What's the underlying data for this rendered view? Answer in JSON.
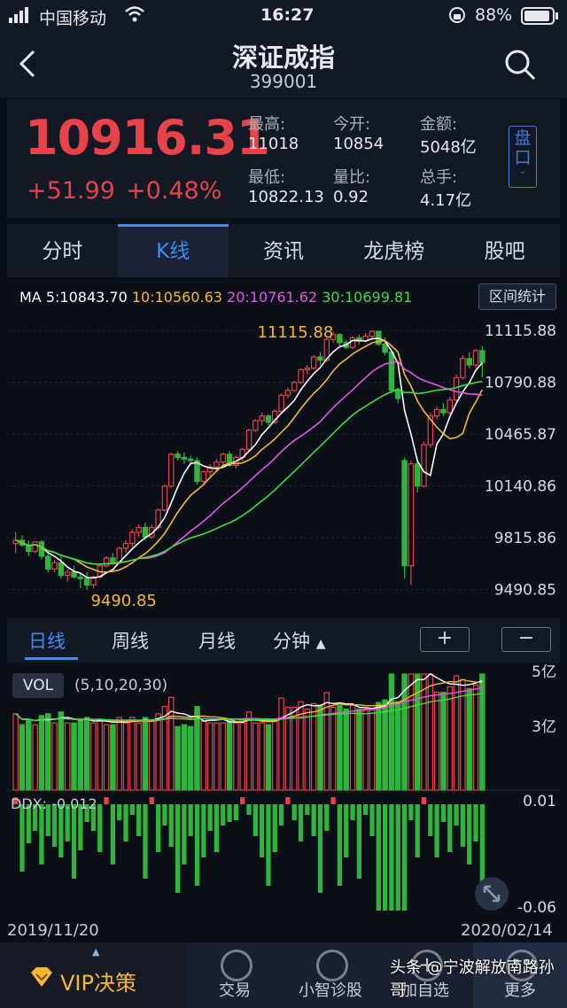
{
  "status_bar": {
    "carrier": "中国移动",
    "time": "16:27",
    "battery": "88%"
  },
  "nav": {
    "title": "深证成指",
    "code": "399001"
  },
  "quote": {
    "price": "10916.31",
    "change": "+51.99",
    "change_pct": "+0.48%",
    "fields": [
      {
        "label": "最高:",
        "value": "11018"
      },
      {
        "label": "今开:",
        "value": "10854"
      },
      {
        "label": "金额:",
        "value": "5048亿"
      },
      {
        "label": "最低:",
        "value": "10822.13"
      },
      {
        "label": "量比:",
        "value": "0.92"
      },
      {
        "label": "总手:",
        "value": "4.17亿"
      }
    ],
    "pankou_label": "盘口"
  },
  "tabs": [
    {
      "label": "分时",
      "active": false
    },
    {
      "label": "K线",
      "active": true
    },
    {
      "label": "资讯",
      "active": false
    },
    {
      "label": "龙虎榜",
      "active": false
    },
    {
      "label": "股吧",
      "active": false
    }
  ],
  "ma_legend": {
    "ma5": "MA 5:10843.70",
    "ma10": "10:10560.63",
    "ma20": "20:10761.62",
    "ma30": "30:10699.81",
    "ma5_color": "#ffffff",
    "ma10_color": "#f5b835",
    "ma20_color": "#e457e6",
    "ma30_color": "#3fdc3f"
  },
  "range_stat_label": "区间统计",
  "period_tabs": {
    "day": "日线",
    "week": "周线",
    "month": "月线",
    "minute": "分钟",
    "plus": "+",
    "minus": "−"
  },
  "vol_legend": {
    "label": "VOL",
    "params": "(5,10,20,30)"
  },
  "ddx_label": "DDX: -0.012",
  "dates": {
    "start": "2019/11/20",
    "end": "2020/02/14"
  },
  "bottom_bar": {
    "vip": "VIP决策",
    "trade": "交易",
    "diagnose": "小智诊股",
    "add": "加自选",
    "more": "更多"
  },
  "watermark": "头条 @宁波解放南路孙哥",
  "chart_data": {
    "type": "candlestick",
    "y_axis_labels": [
      "11115.88",
      "10790.88",
      "10465.87",
      "10140.86",
      "9815.86",
      "9490.85"
    ],
    "ylim": [
      9400,
      11200
    ],
    "annotations": {
      "high": "11115.88",
      "low": "9490.85"
    },
    "ohlc": [
      [
        9780,
        9850,
        9720,
        9800
      ],
      [
        9800,
        9830,
        9760,
        9770
      ],
      [
        9770,
        9800,
        9700,
        9730
      ],
      [
        9730,
        9790,
        9720,
        9790
      ],
      [
        9790,
        9800,
        9680,
        9700
      ],
      [
        9700,
        9730,
        9600,
        9620
      ],
      [
        9620,
        9680,
        9600,
        9660
      ],
      [
        9660,
        9700,
        9560,
        9580
      ],
      [
        9580,
        9620,
        9540,
        9600
      ],
      [
        9600,
        9640,
        9560,
        9570
      ],
      [
        9570,
        9600,
        9500,
        9560
      ],
      [
        9560,
        9600,
        9490,
        9520
      ],
      [
        9520,
        9580,
        9500,
        9570
      ],
      [
        9570,
        9650,
        9560,
        9640
      ],
      [
        9640,
        9700,
        9630,
        9690
      ],
      [
        9690,
        9720,
        9650,
        9660
      ],
      [
        9660,
        9760,
        9650,
        9750
      ],
      [
        9750,
        9800,
        9720,
        9780
      ],
      [
        9780,
        9870,
        9760,
        9850
      ],
      [
        9850,
        9900,
        9820,
        9880
      ],
      [
        9880,
        9910,
        9800,
        9820
      ],
      [
        9820,
        9900,
        9810,
        9880
      ],
      [
        9880,
        10000,
        9870,
        9990
      ],
      [
        9990,
        10150,
        9980,
        10140
      ],
      [
        10140,
        10350,
        10130,
        10340
      ],
      [
        10340,
        10360,
        10300,
        10320
      ],
      [
        10320,
        10350,
        10280,
        10310
      ],
      [
        10310,
        10330,
        10270,
        10300
      ],
      [
        10300,
        10320,
        10150,
        10170
      ],
      [
        10170,
        10240,
        10150,
        10230
      ],
      [
        10230,
        10280,
        10200,
        10260
      ],
      [
        10260,
        10310,
        10230,
        10290
      ],
      [
        10290,
        10350,
        10270,
        10340
      ],
      [
        10340,
        10360,
        10260,
        10270
      ],
      [
        10270,
        10330,
        10250,
        10320
      ],
      [
        10320,
        10380,
        10300,
        10370
      ],
      [
        10370,
        10500,
        10360,
        10490
      ],
      [
        10490,
        10560,
        10480,
        10550
      ],
      [
        10550,
        10600,
        10520,
        10580
      ],
      [
        10580,
        10590,
        10520,
        10540
      ],
      [
        10540,
        10620,
        10530,
        10610
      ],
      [
        10610,
        10720,
        10600,
        10710
      ],
      [
        10710,
        10760,
        10690,
        10740
      ],
      [
        10740,
        10800,
        10730,
        10790
      ],
      [
        10790,
        10880,
        10780,
        10870
      ],
      [
        10870,
        10900,
        10840,
        10880
      ],
      [
        10880,
        10960,
        10870,
        10950
      ],
      [
        10950,
        10980,
        10900,
        10930
      ],
      [
        10930,
        11070,
        10920,
        11060
      ],
      [
        11060,
        11110,
        11040,
        11090
      ],
      [
        11090,
        11100,
        11020,
        11040
      ],
      [
        11040,
        11060,
        11000,
        11010
      ],
      [
        11010,
        11080,
        11000,
        11070
      ],
      [
        11070,
        11090,
        11030,
        11050
      ],
      [
        11050,
        11100,
        11040,
        11080
      ],
      [
        11080,
        11116,
        11060,
        11110
      ],
      [
        11110,
        11116,
        11020,
        11030
      ],
      [
        11030,
        11070,
        10960,
        10980
      ],
      [
        10980,
        10990,
        10720,
        10740
      ],
      [
        10740,
        10760,
        10660,
        10690
      ],
      [
        10300,
        10320,
        9560,
        9640
      ],
      [
        9640,
        10300,
        9520,
        10280
      ],
      [
        10280,
        10320,
        10100,
        10140
      ],
      [
        10140,
        10420,
        10130,
        10400
      ],
      [
        10400,
        10600,
        10380,
        10580
      ],
      [
        10580,
        10640,
        10560,
        10620
      ],
      [
        10620,
        10660,
        10580,
        10600
      ],
      [
        10600,
        10700,
        10590,
        10680
      ],
      [
        10680,
        10840,
        10670,
        10820
      ],
      [
        10820,
        10960,
        10810,
        10940
      ],
      [
        10940,
        10980,
        10880,
        10900
      ],
      [
        10900,
        11000,
        10880,
        10990
      ],
      [
        10990,
        11018,
        10822,
        10916
      ]
    ]
  }
}
